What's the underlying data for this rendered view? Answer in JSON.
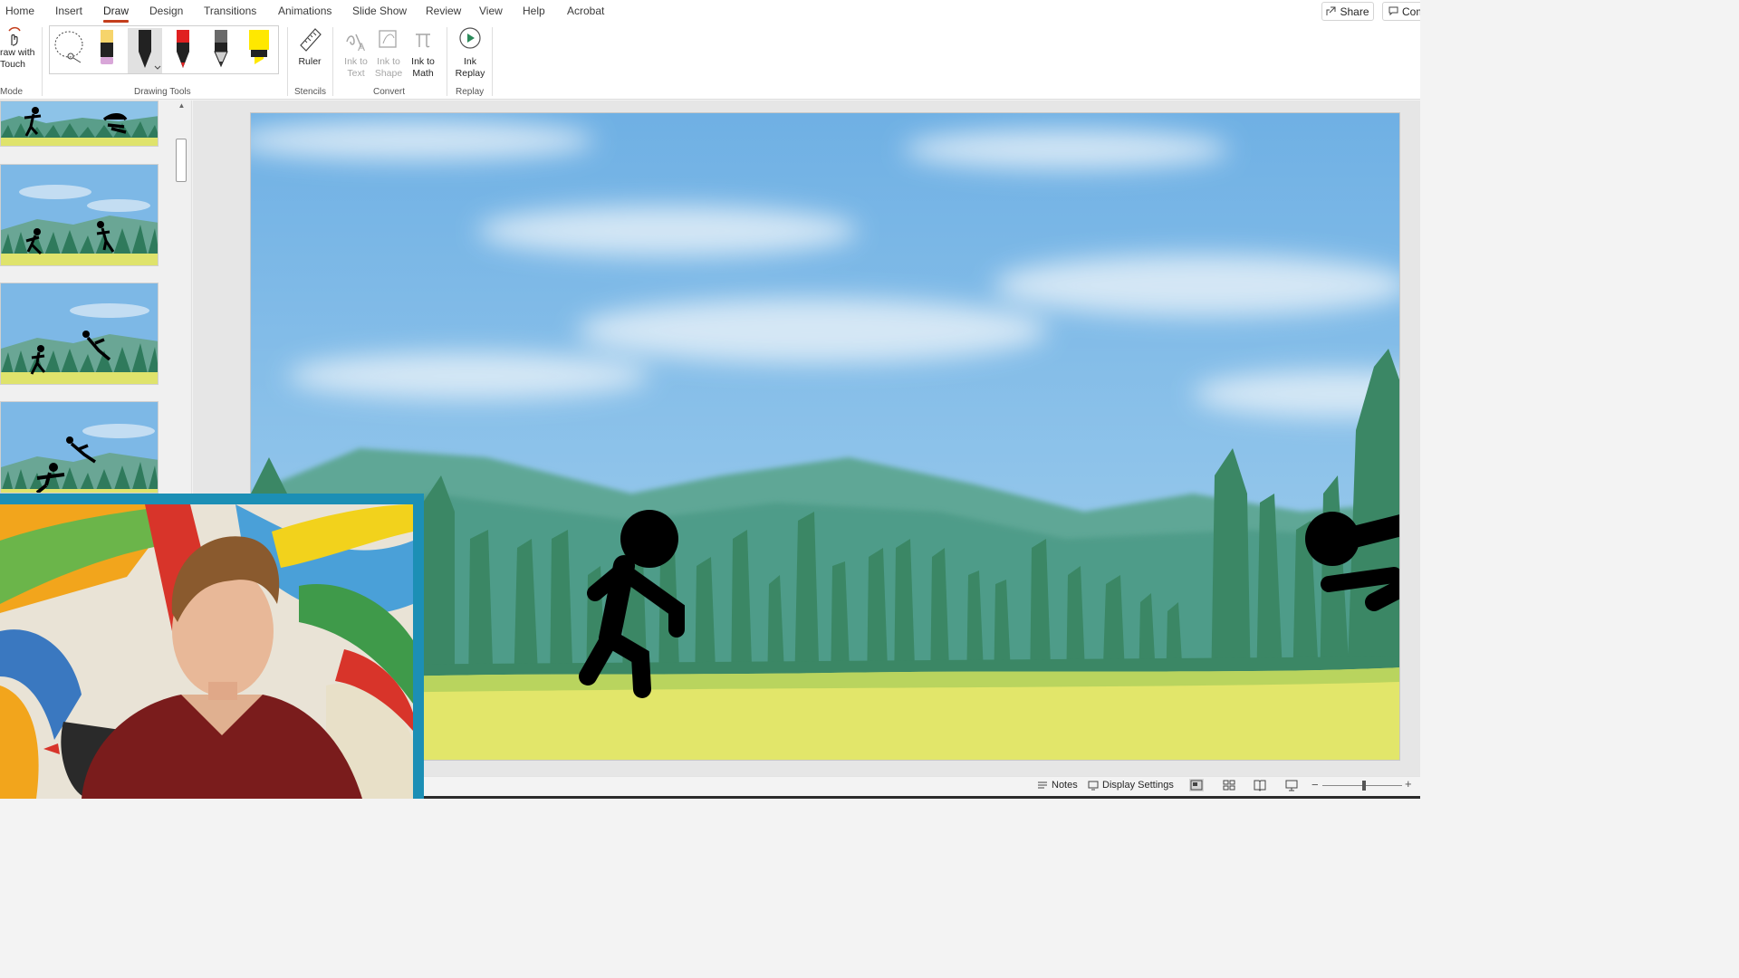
{
  "ribbon_tabs": [
    "Home",
    "Insert",
    "Draw",
    "Design",
    "Transitions",
    "Animations",
    "Slide Show",
    "Review",
    "View",
    "Help",
    "Acrobat"
  ],
  "active_tab": "Draw",
  "header_buttons": {
    "share": "Share",
    "comments": "Com"
  },
  "ribbon": {
    "draw_with_touch": "raw with\nTouch",
    "mode_label": "Mode",
    "drawing_tools_label": "Drawing Tools",
    "ruler": "Ruler",
    "stencils_label": "Stencils",
    "ink_to_text": "Ink to\nText",
    "ink_to_shape": "Ink to\nShape",
    "ink_to_math": "Ink to\nMath",
    "convert_label": "Convert",
    "ink_replay": "Ink\nReplay",
    "replay_label": "Replay",
    "pen_colors": [
      "#f6d46b",
      "#000000",
      "#e02020",
      "#5a5a5a",
      "#ffe800"
    ]
  },
  "status_bar": {
    "notes": "Notes",
    "display_settings": "Display Settings"
  },
  "colors": {
    "accent": "#c43e1c",
    "sky_top": "#5da8e2",
    "grass": "#e4e66a",
    "trees": "#3f8e6b",
    "webcam_border": "#1c8fb5"
  }
}
